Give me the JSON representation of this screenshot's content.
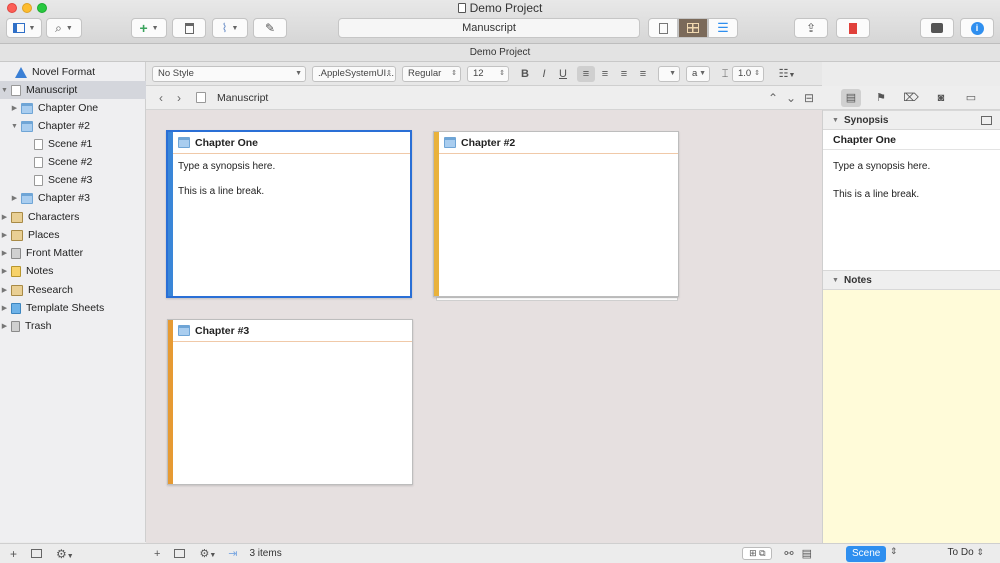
{
  "window": {
    "title": "Demo Project"
  },
  "toolbar": {
    "center_title": "Manuscript",
    "add_label": "+",
    "colors": {
      "add": "#3aa35c",
      "bookmark": "#e0403a",
      "info": "#2f8fef"
    }
  },
  "project_bar": {
    "title": "Demo Project"
  },
  "binder": {
    "items": [
      {
        "label": "Novel Format",
        "icon": "warning-icon"
      },
      {
        "label": "Manuscript",
        "icon": "manuscript-icon"
      },
      {
        "label": "Chapter One",
        "icon": "folder-icon"
      },
      {
        "label": "Chapter #2",
        "icon": "folder-icon"
      },
      {
        "label": "Scene #1",
        "icon": "document-icon"
      },
      {
        "label": "Scene #2",
        "icon": "document-icon"
      },
      {
        "label": "Scene #3",
        "icon": "document-icon"
      },
      {
        "label": "Chapter #3",
        "icon": "folder-icon"
      },
      {
        "label": "Characters",
        "icon": "characters-icon"
      },
      {
        "label": "Places",
        "icon": "places-icon"
      },
      {
        "label": "Front Matter",
        "icon": "front-matter-icon"
      },
      {
        "label": "Notes",
        "icon": "notes-icon"
      },
      {
        "label": "Research",
        "icon": "research-icon"
      },
      {
        "label": "Template Sheets",
        "icon": "template-icon"
      },
      {
        "label": "Trash",
        "icon": "trash-icon"
      }
    ]
  },
  "format_bar": {
    "style": "No Style",
    "font": ".AppleSystemUI...",
    "weight": "Regular",
    "size": "12",
    "bold": "B",
    "italic": "I",
    "underline": "U",
    "highlight": "a",
    "line_spacing": "1.0"
  },
  "editor": {
    "header_title": "Manuscript",
    "cards": [
      {
        "title": "Chapter One",
        "line1": "Type a synopsis here.",
        "line2": "This is a line break.",
        "label_color": "#3a86d8"
      },
      {
        "title": "Chapter #2",
        "line1": "",
        "line2": "",
        "label_color": "#e9b23c"
      },
      {
        "title": "Chapter #3",
        "line1": "",
        "line2": "",
        "label_color": "#e69a33"
      }
    ],
    "footer_count": "3 items"
  },
  "inspector": {
    "synopsis_header": "Synopsis",
    "synopsis_title": "Chapter One",
    "synopsis_line1": "Type a synopsis here.",
    "synopsis_line2": "This is a line break.",
    "notes_header": "Notes",
    "status": "Scene",
    "label": "To Do"
  }
}
